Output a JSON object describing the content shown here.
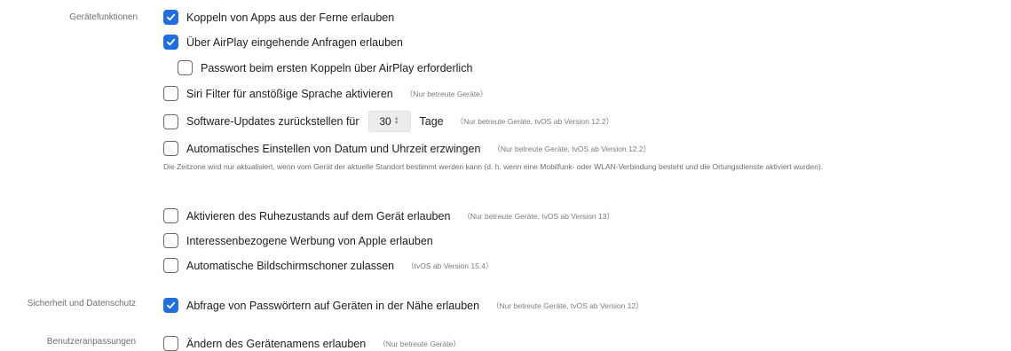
{
  "sections": {
    "device_functions": "Gerätefunktionen",
    "security": "Sicherheit und Datenschutz",
    "user_customizations": "Benutzeranpassungen"
  },
  "items": {
    "remote_app_pairing": {
      "label": "Koppeln von Apps aus der Ferne erlauben",
      "checked": true
    },
    "airplay_incoming": {
      "label": "Über AirPlay eingehende Anfragen erlauben",
      "checked": true
    },
    "airplay_password": {
      "label": "Passwort beim ersten Koppeln über AirPlay erforderlich",
      "checked": false
    },
    "siri_filter": {
      "label": "Siri Filter für anstößige Sprache aktivieren",
      "note": "（Nur betreute Geräte）",
      "checked": false
    },
    "software_updates": {
      "label": "Software-Updates zurückstellen für",
      "value": "30",
      "unit": "Tage",
      "note": "（Nur betreute Geräte, tvOS ab Version 12.2）",
      "checked": false
    },
    "auto_datetime": {
      "label": "Automatisches Einstellen von Datum und Uhrzeit erzwingen",
      "note": "（Nur betreute Geräte, tvOS ab Version 12.2）",
      "checked": false
    },
    "timezone_desc": "Die Zeitzone wird nur aktualisiert, wenn vom Gerät der aktuelle Standort bestimmt werden kann (d. h. wenn eine Mobilfunk- oder WLAN-Verbindung besteht und die Ortungsdienste aktiviert wurden).",
    "sleep_mode": {
      "label": "Aktivieren des Ruhezustands auf dem Gerät erlauben",
      "note": "（Nur betreute Geräte, tvOS ab Version 13）",
      "checked": false
    },
    "ads": {
      "label": "Interessenbezogene Werbung von Apple erlauben",
      "checked": false
    },
    "screensaver": {
      "label": "Automatische Bildschirmschoner zulassen",
      "note": "（tvOS ab Version 15.4）",
      "checked": false
    },
    "password_request": {
      "label": "Abfrage von Passwörtern auf Geräten in der Nähe erlauben",
      "note": "（Nur betreute Geräte, tvOS ab Version 12）",
      "checked": true
    },
    "device_name": {
      "label": "Ändern des Gerätenamens erlauben",
      "note": "（Nur betreute Geräte）",
      "checked": false
    }
  },
  "colors": {
    "accent": "#1f6fe0",
    "text": "#1d1d1f",
    "muted": "#7c7c80"
  },
  "icons": {
    "check": "checkmark-icon",
    "stepper": "stepper-arrows-icon"
  }
}
